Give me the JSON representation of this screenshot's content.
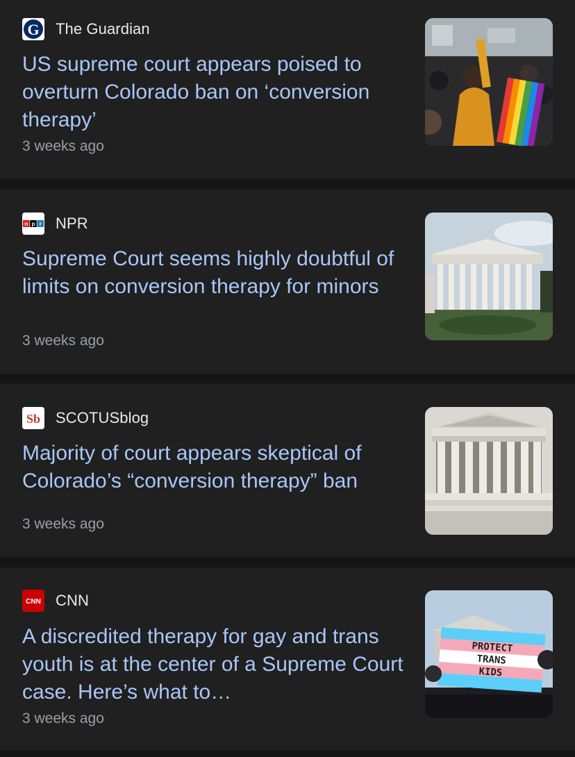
{
  "articles": [
    {
      "source": "The Guardian",
      "logo_icon": "guardian-logo-icon",
      "headline": "US supreme court appears poised to overturn Colorado ban on ‘conversion therapy’",
      "time": "3 weeks ago",
      "thumbnail": "protest-crowd-rainbow-flag-image"
    },
    {
      "source": "NPR",
      "logo_icon": "npr-logo-icon",
      "headline": "Supreme Court seems highly doubtful of limits on conversion therapy for minors",
      "time": "3 weeks ago",
      "thumbnail": "supreme-court-building-image"
    },
    {
      "source": "SCOTUSblog",
      "logo_icon": "scotusblog-logo-icon",
      "headline": "Majority of court appears skeptical of Colorado’s “conversion therapy” ban",
      "time": "3 weeks ago",
      "thumbnail": "supreme-court-facade-image"
    },
    {
      "source": "CNN",
      "logo_icon": "cnn-logo-icon",
      "headline": "A discredited therapy for gay and trans youth is at the center of a Supreme Court case. Here’s what to…",
      "time": "3 weeks ago",
      "thumbnail": "protect-trans-kids-flag-image",
      "thumbnail_text": [
        "PROTECT",
        "TRANS",
        "KIDS"
      ]
    }
  ],
  "logos": {
    "guardian_letter": "G",
    "npr_letters": [
      "n",
      "p",
      "r"
    ],
    "scotusblog_letters": "Sb",
    "cnn_letters": "CNN"
  },
  "colors": {
    "background": "#151515",
    "card": "#202020",
    "headline": "#a8c7fa",
    "source": "#e8eaed",
    "time": "#9aa0a6"
  }
}
